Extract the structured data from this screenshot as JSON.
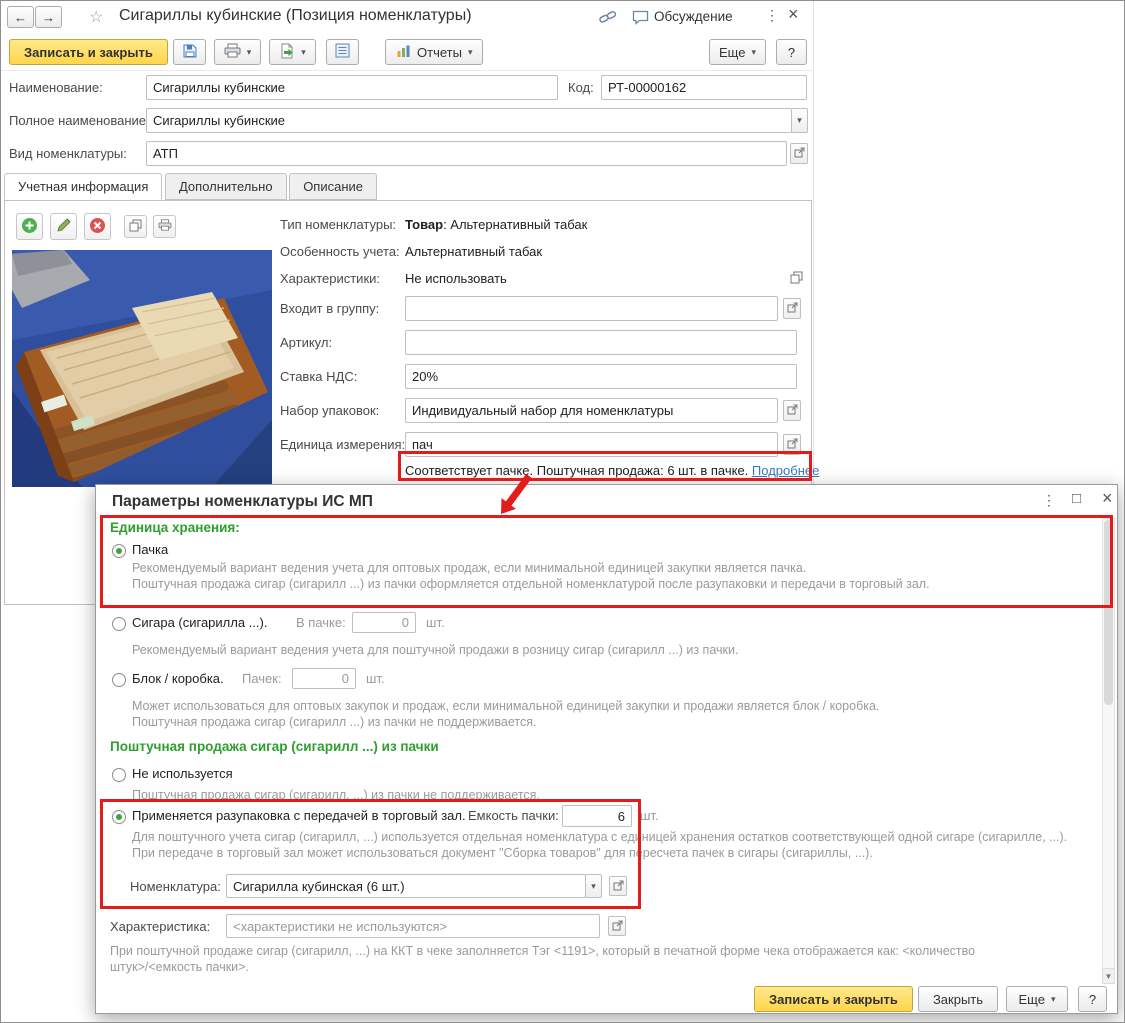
{
  "colors": {
    "annotation_red": "#E31B1B",
    "accent_yellow": "#FFD64A",
    "header_green": "#2E9E2E",
    "link_blue": "#3779C0",
    "radio_selected_green": "#3FA43F"
  },
  "icons": {
    "back": "←",
    "forward": "→",
    "star": "☆",
    "kebab": "⋮",
    "close": "×",
    "maximize": "□",
    "dropdown": "▾",
    "scroll_down": "▼",
    "help": "?"
  },
  "window": {
    "title": "Сигариллы кубинские (Позиция номенклатуры)",
    "discussion": "Обсуждение",
    "toolbar": {
      "save_close": "Записать и закрыть",
      "reports": "Отчеты",
      "more": "Еще"
    },
    "fields": {
      "name": {
        "label": "Наименование:",
        "value": "Сигариллы кубинские"
      },
      "code": {
        "label": "Код:",
        "value": "РТ-00000162"
      },
      "full_name": {
        "label": "Полное наименование:",
        "value": "Сигариллы кубинские"
      },
      "kind": {
        "label": "Вид номенклатуры:",
        "value": "АТП"
      }
    },
    "tabs": {
      "accounting": "Учетная информация",
      "additional": "Дополнительно",
      "description": "Описание"
    },
    "info": {
      "type": {
        "label": "Тип номенклатуры:",
        "bold": "Товар",
        "rest": ": Альтернативный табак"
      },
      "feature": {
        "label": "Особенность учета:",
        "value": "Альтернативный табак"
      },
      "characteristics": {
        "label": "Характеристики:",
        "value": "Не использовать"
      },
      "group": {
        "label": "Входит в группу:",
        "value": ""
      },
      "article": {
        "label": "Артикул:",
        "value": ""
      },
      "vat": {
        "label": "Ставка НДС:",
        "value": "20%"
      },
      "packs": {
        "label": "Набор упаковок:",
        "value": "Индивидуальный набор для номенклатуры"
      },
      "unit": {
        "label": "Единица измерения:",
        "value": "пач"
      },
      "note": "Соответствует пачке. Поштучная продажа: 6 шт. в пачке.",
      "details_link": "Подробнее"
    }
  },
  "dialog": {
    "title": "Параметры номенклатуры ИС МП",
    "storage": {
      "header": "Единица хранения:",
      "pack": {
        "label": "Пачка",
        "desc": "Рекомендуемый вариант ведения учета для оптовых продаж, если минимальной единицей закупки является пачка.\nПоштучная продажа сигар (сигарилл ...) из пачки оформляется отдельной номенклатурой после разупаковки и передачи в торговый зал."
      },
      "cigar": {
        "label": "Сигара (сигарилла ...).",
        "qty_label": "В пачке:",
        "qty_value": "0",
        "unit": "шт.",
        "desc": "Рекомендуемый вариант ведения учета для поштучной продажи в розницу сигар (сигарилл ...) из пачки."
      },
      "box": {
        "label": "Блок / коробка.",
        "qty_label": "Пачек:",
        "qty_value": "0",
        "unit": "шт.",
        "desc": "Может использоваться для оптовых закупок и продаж, если минимальной единицей закупки и продажи является блок / коробка.\nПоштучная продажа сигар (сигарилл ...) из пачки не поддерживается."
      }
    },
    "piece_sale": {
      "header": "Поштучная продажа сигар (сигарилл ...) из пачки",
      "not_used": {
        "label": "Не используется",
        "desc": "Поштучная продажа сигар (сигарилл, ...) из пачки не поддерживается."
      },
      "unpack": {
        "label": "Применяется разупаковка с передачей в торговый зал.",
        "capacity_label": "Емкость пачки:",
        "capacity_value": "6",
        "unit": "шт.",
        "desc": "Для поштучного учета сигар (сигарилл, ...) используется отдельная номенклатура с единицей хранения остатков соответствующей одной сигаре (сигарилле, ...).\nПри передаче в торговый зал может использоваться документ \"Сборка товаров\" для пересчета пачек в сигары (сигариллы, ...).",
        "nomenclature_label": "Номенклатура:",
        "nomenclature_value": "Сигарилла кубинская (6 шт.)"
      },
      "characteristic": {
        "label": "Характеристика:",
        "value": "<характеристики не используются>"
      },
      "footnote": "При поштучной продаже сигар (сигарилл, ...) на ККТ в чеке заполняется Тэг <1191>, который в печатной форме чека отображается как: <количество\nштук>/<емкость пачки>."
    },
    "buttons": {
      "save_close": "Записать и закрыть",
      "close": "Закрыть",
      "more": "Еще"
    }
  }
}
